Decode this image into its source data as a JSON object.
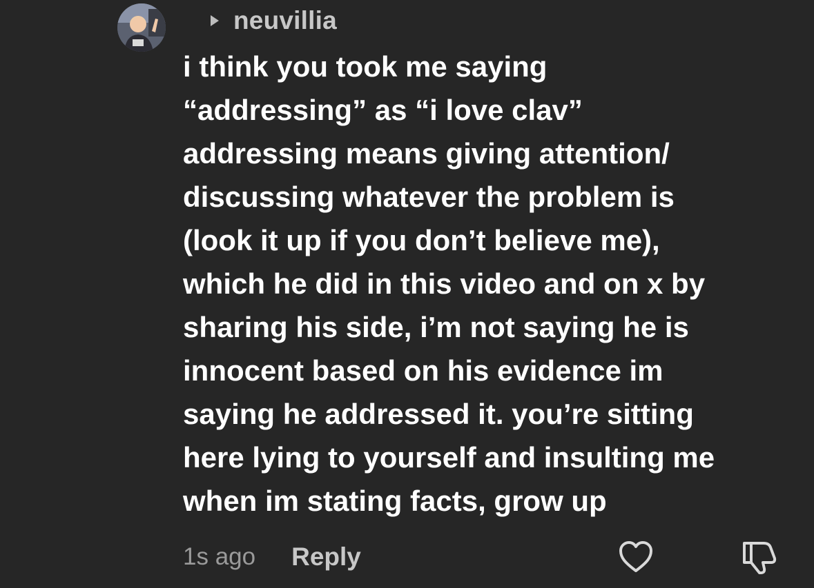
{
  "comment": {
    "avatar_icon": "user-avatar",
    "reply_indicator_icon": "caret-right-icon",
    "reply_to_username": "neuvillia",
    "text_lines": [
      "i think you took me saying",
      "“addressing” as “i love clav”",
      "addressing means giving attention/",
      "discussing whatever the problem is",
      "(look it up if you don’t believe me),",
      "which he did in this video and on x by",
      "sharing his side, i’m not saying he is",
      "innocent based on his evidence im",
      "saying he addressed it. you’re sitting",
      "here lying to yourself and insulting me",
      "when im stating facts, grow up"
    ],
    "timestamp": "1s ago",
    "reply_label": "Reply",
    "like_icon": "heart-icon",
    "dislike_icon": "thumbs-down-icon"
  },
  "colors": {
    "background": "#262626",
    "text": "#ffffff",
    "muted": "#9a9a9a",
    "username": "#c7c7c7"
  }
}
